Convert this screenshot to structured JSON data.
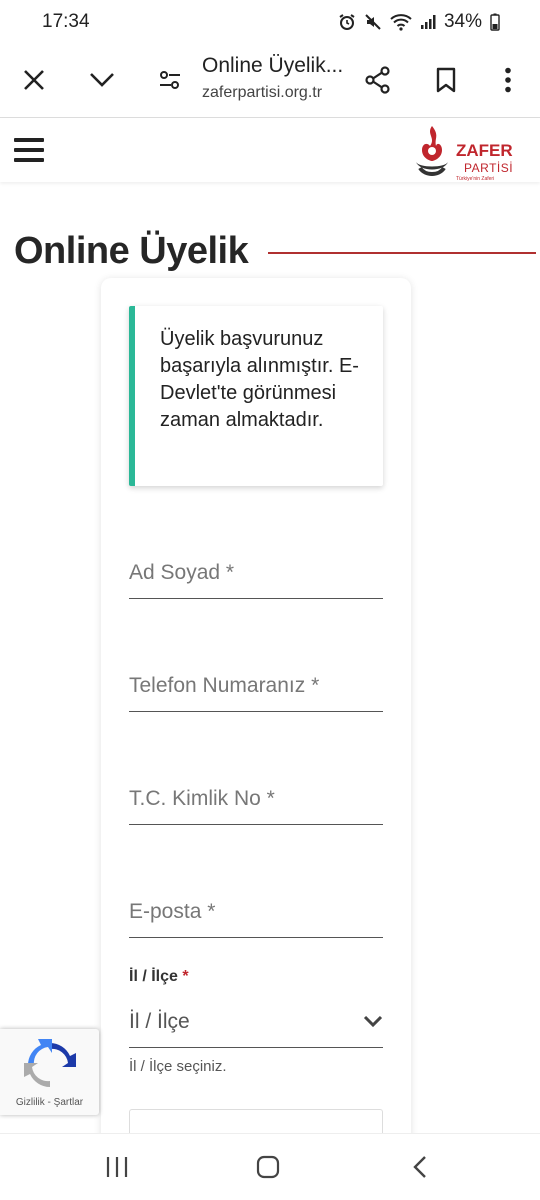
{
  "status_bar": {
    "time": "17:34",
    "battery": "34%"
  },
  "browser": {
    "title": "Online Üyelik...",
    "url": "zaferpartisi.org.tr"
  },
  "logo": {
    "name": "ZAFER",
    "sub": "PARTİSİ",
    "tagline": "Türkiye'nin Zaferi"
  },
  "page": {
    "title": "Online Üyelik"
  },
  "alert": {
    "message": "Üyelik başvurunuz başarıyla alınmıştır. E-Devlet'te görünmesi zaman almaktadır."
  },
  "form": {
    "name_placeholder": "Ad Soyad *",
    "phone_placeholder": "Telefon Numaranız *",
    "tc_placeholder": "T.C. Kimlik No *",
    "email_placeholder": "E-posta *",
    "city_label": "İl / İlçe",
    "city_required_mark": "*",
    "city_value": "İl / İlçe",
    "city_helper": "İl / İlçe seçiniz."
  },
  "recaptcha": {
    "links": "Gizlilik - Şartlar"
  },
  "colors": {
    "accent_red": "#c0262d",
    "alert_green": "#2bb897"
  }
}
